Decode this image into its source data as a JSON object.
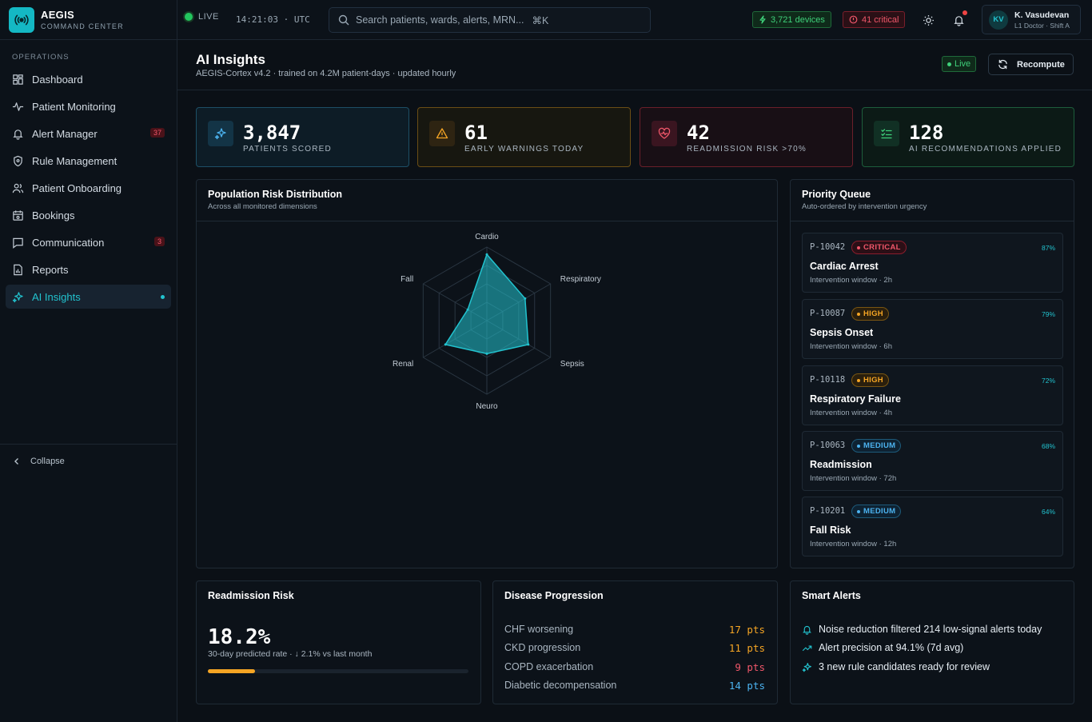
{
  "brand": {
    "name": "AEGIS",
    "subtitle": "COMMAND CENTER"
  },
  "sidebar": {
    "section": "OPERATIONS",
    "items": [
      {
        "label": "Dashboard",
        "icon": "grid-icon"
      },
      {
        "label": "Patient Monitoring",
        "icon": "pulse-icon"
      },
      {
        "label": "Alert Manager",
        "icon": "bell-icon",
        "badge": "37"
      },
      {
        "label": "Rule Management",
        "icon": "shield-icon"
      },
      {
        "label": "Patient Onboarding",
        "icon": "users-icon"
      },
      {
        "label": "Bookings",
        "icon": "calendar-icon"
      },
      {
        "label": "Communication",
        "icon": "message-icon",
        "badge": "3"
      },
      {
        "label": "Reports",
        "icon": "report-icon"
      },
      {
        "label": "AI Insights",
        "icon": "sparkles-icon",
        "active": true
      }
    ],
    "collapse_label": "Collapse"
  },
  "topbar": {
    "live_label": "LIVE",
    "clock": "14:21:03 · UTC",
    "search_placeholder": "Search patients, wards, alerts, MRN...",
    "search_shortcut": "⌘K",
    "devices_chip": "3,721 devices",
    "critical_chip": "41 critical",
    "user": {
      "initials": "KV",
      "name": "K. Vasudevan",
      "role": "L1 Doctor · Shift A"
    }
  },
  "page": {
    "title": "AI Insights",
    "subtitle": "AEGIS-Cortex v4.2 · trained on 4.2M patient-days · updated hourly",
    "live_badge": "Live",
    "recompute_label": "Recompute"
  },
  "stats": [
    {
      "value": "3,847",
      "label": "PATIENTS SCORED",
      "icon": "sparkles-icon",
      "color": "#4cb3f0"
    },
    {
      "value": "61",
      "label": "EARLY WARNINGS TODAY",
      "icon": "warning-icon",
      "color": "#f5a524"
    },
    {
      "value": "42",
      "label": "READMISSION RISK >70%",
      "icon": "heart-pulse-icon",
      "color": "#f0576a"
    },
    {
      "value": "128",
      "label": "AI RECOMMENDATIONS APPLIED",
      "icon": "checklist-icon",
      "color": "#3fd07a"
    }
  ],
  "risk_panel": {
    "title": "Population Risk Distribution",
    "subtitle": "Across all monitored dimensions"
  },
  "chart_data": {
    "type": "radar",
    "axes": [
      "Cardio",
      "Respiratory",
      "Sepsis",
      "Neuro",
      "Renal",
      "Fall"
    ],
    "values": [
      0.9,
      0.6,
      0.65,
      0.45,
      0.65,
      0.3
    ],
    "rmax": 1,
    "rings": 4,
    "color": "#22c3cf"
  },
  "priority_queue": {
    "title": "Priority Queue",
    "subtitle": "Auto-ordered by intervention urgency",
    "items": [
      {
        "id": "P-10042",
        "level": "CRITICAL",
        "pct": "87%",
        "title": "Cardiac Arrest",
        "window": "Intervention window · 2h"
      },
      {
        "id": "P-10087",
        "level": "HIGH",
        "pct": "79%",
        "title": "Sepsis Onset",
        "window": "Intervention window · 6h"
      },
      {
        "id": "P-10118",
        "level": "HIGH",
        "pct": "72%",
        "title": "Respiratory Failure",
        "window": "Intervention window · 4h"
      },
      {
        "id": "P-10063",
        "level": "MEDIUM",
        "pct": "68%",
        "title": "Readmission",
        "window": "Intervention window · 72h"
      },
      {
        "id": "P-10201",
        "level": "MEDIUM",
        "pct": "64%",
        "title": "Fall Risk",
        "window": "Intervention window · 12h"
      }
    ]
  },
  "readmission": {
    "title": "Readmission Risk",
    "value": "18.2%",
    "subtitle": "30-day predicted rate · ↓ 2.1% vs last month",
    "progress": 0.182
  },
  "disease_progression": {
    "title": "Disease Progression",
    "rows": [
      {
        "label": "CHF worsening",
        "value": "17 pts",
        "color": "#f5a524"
      },
      {
        "label": "CKD progression",
        "value": "11 pts",
        "color": "#f5a524"
      },
      {
        "label": "COPD exacerbation",
        "value": "9 pts",
        "color": "#f0576a"
      },
      {
        "label": "Diabetic decompensation",
        "value": "14 pts",
        "color": "#4cb3f0"
      }
    ]
  },
  "smart_alerts": {
    "title": "Smart Alerts",
    "rows": [
      {
        "text": "Noise reduction filtered 214 low-signal alerts today",
        "icon": "bell-icon"
      },
      {
        "text": "Alert precision at 94.1% (7d avg)",
        "icon": "trend-up-icon"
      },
      {
        "text": "3 new rule candidates ready for review",
        "icon": "sparkles-icon"
      }
    ]
  }
}
